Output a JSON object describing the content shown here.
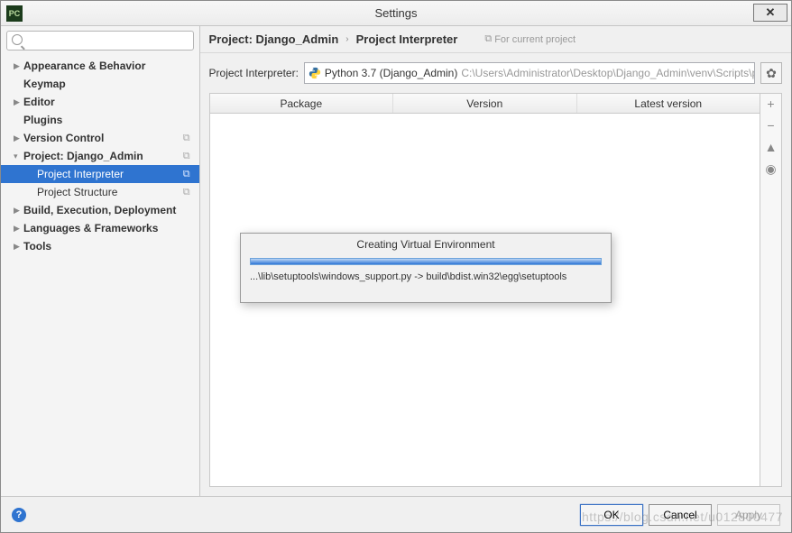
{
  "window": {
    "title": "Settings",
    "app_icon_text": "PC"
  },
  "search": {
    "placeholder": ""
  },
  "sidebar": {
    "items": [
      {
        "label": "Appearance & Behavior",
        "expandable": true,
        "expanded": false,
        "bold": true
      },
      {
        "label": "Keymap",
        "expandable": false,
        "bold": true
      },
      {
        "label": "Editor",
        "expandable": true,
        "expanded": false,
        "bold": true
      },
      {
        "label": "Plugins",
        "expandable": false,
        "bold": true
      },
      {
        "label": "Version Control",
        "expandable": true,
        "expanded": false,
        "bold": true,
        "right_icon": "copy-icon"
      },
      {
        "label": "Project: Django_Admin",
        "expandable": true,
        "expanded": true,
        "bold": true,
        "right_icon": "copy-icon"
      },
      {
        "label": "Project Interpreter",
        "child": true,
        "selected": true,
        "right_icon": "copy-icon"
      },
      {
        "label": "Project Structure",
        "child": true,
        "right_icon": "copy-icon"
      },
      {
        "label": "Build, Execution, Deployment",
        "expandable": true,
        "expanded": false,
        "bold": true
      },
      {
        "label": "Languages & Frameworks",
        "expandable": true,
        "expanded": false,
        "bold": true
      },
      {
        "label": "Tools",
        "expandable": true,
        "expanded": false,
        "bold": true
      }
    ]
  },
  "breadcrumb": {
    "project": "Project: Django_Admin",
    "page": "Project Interpreter",
    "scope": "For current project"
  },
  "interpreter": {
    "label": "Project Interpreter:",
    "selected_name": "Python 3.7 (Django_Admin)",
    "selected_path": "C:\\Users\\Administrator\\Desktop\\Django_Admin\\venv\\Scripts\\pyth…"
  },
  "table": {
    "columns": [
      "Package",
      "Version",
      "Latest version"
    ],
    "rows": []
  },
  "side_buttons": {
    "add": "add-icon",
    "remove": "remove-icon",
    "up": "up-icon",
    "eye": "eye-icon"
  },
  "modal": {
    "title": "Creating Virtual Environment",
    "status": "...\\lib\\setuptools\\windows_support.py -> build\\bdist.win32\\egg\\setuptools"
  },
  "footer": {
    "ok": "OK",
    "cancel": "Cancel",
    "apply": "Apply"
  },
  "watermark": "https://blog.csdn.net/u012800477"
}
